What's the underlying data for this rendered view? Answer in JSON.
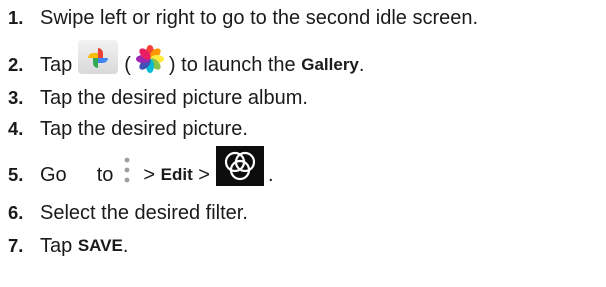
{
  "steps": [
    {
      "num": "1.",
      "text": "Swipe left or right to go to the second idle screen."
    },
    {
      "num": "2.",
      "pre": "Tap",
      "paren_open": "(",
      "paren_close": ") to launch the",
      "bold": "Gallery",
      "post": "."
    },
    {
      "num": "3.",
      "text": "Tap the desired picture album."
    },
    {
      "num": "4.",
      "text": "Tap the desired picture."
    },
    {
      "num": "5.",
      "go": "Go",
      "to": "to",
      "sep1": ">",
      "bold": "Edit",
      "sep2": ">",
      "post": "."
    },
    {
      "num": "6.",
      "text": "Select the desired filter."
    },
    {
      "num": "7.",
      "pre": "Tap",
      "bold": "SAVE",
      "post": "."
    }
  ],
  "icons": {
    "google_photos": "google-photos-icon",
    "gallery": "gallery-flower-icon",
    "more": "more-options-icon",
    "filter": "filter-icon"
  },
  "colors": {
    "text": "#1a1a1a",
    "filter_bg": "#0d0d0d"
  }
}
